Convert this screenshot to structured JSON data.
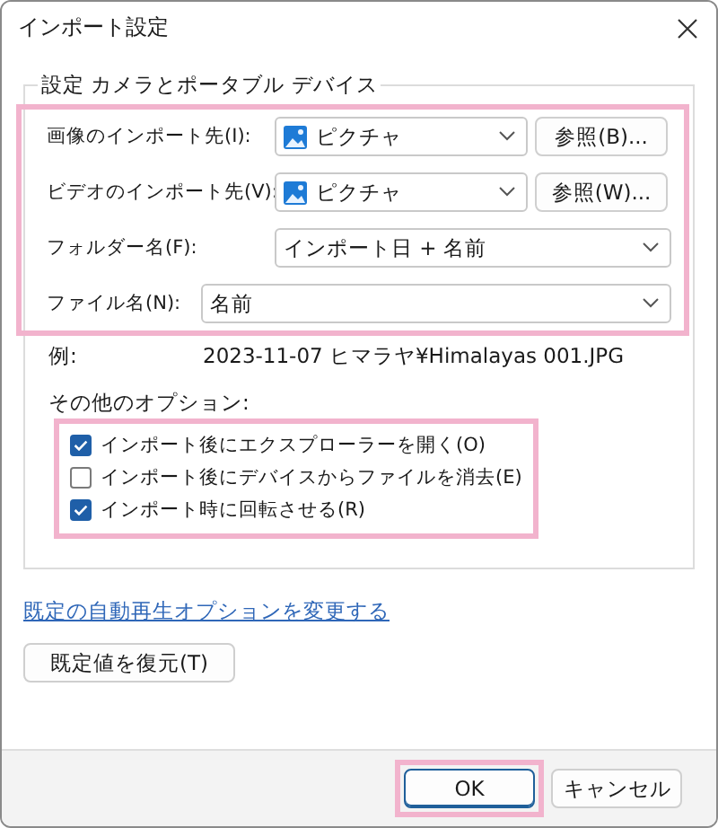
{
  "window": {
    "title": "インポート設定"
  },
  "group": {
    "title": "設定 カメラとポータブル デバイス"
  },
  "fields": {
    "highlight": true,
    "rows": [
      {
        "kind": "destination",
        "label": "画像のインポート先(I):",
        "value": "ピクチャ",
        "browse": "参照(B)..."
      },
      {
        "kind": "destination",
        "label": "ビデオのインポート先(V):",
        "value": "ピクチャ",
        "browse": "参照(W)..."
      },
      {
        "kind": "combo",
        "label": "フォルダー名(F):",
        "value": "インポート日 + 名前"
      },
      {
        "kind": "wide-combo",
        "label": "ファイル名(N):",
        "value": "名前"
      }
    ]
  },
  "example": {
    "label": "例:",
    "value": "2023-11-07 ヒマラヤ¥Himalayas 001.JPG"
  },
  "options": {
    "label": "その他のオプション:",
    "highlight": true,
    "items": [
      {
        "label": "インポート後にエクスプローラーを開く(O)",
        "checked": true
      },
      {
        "label": "インポート後にデバイスからファイルを消去(E)",
        "checked": false
      },
      {
        "label": "インポート時に回転させる(R)",
        "checked": true
      }
    ]
  },
  "link": "既定の自動再生オプションを変更する",
  "restore_button": "既定値を復元(T)",
  "buttons": [
    {
      "label": "OK",
      "default": true,
      "highlight": true
    },
    {
      "label": "キャンセル",
      "default": false,
      "highlight": false
    }
  ]
}
